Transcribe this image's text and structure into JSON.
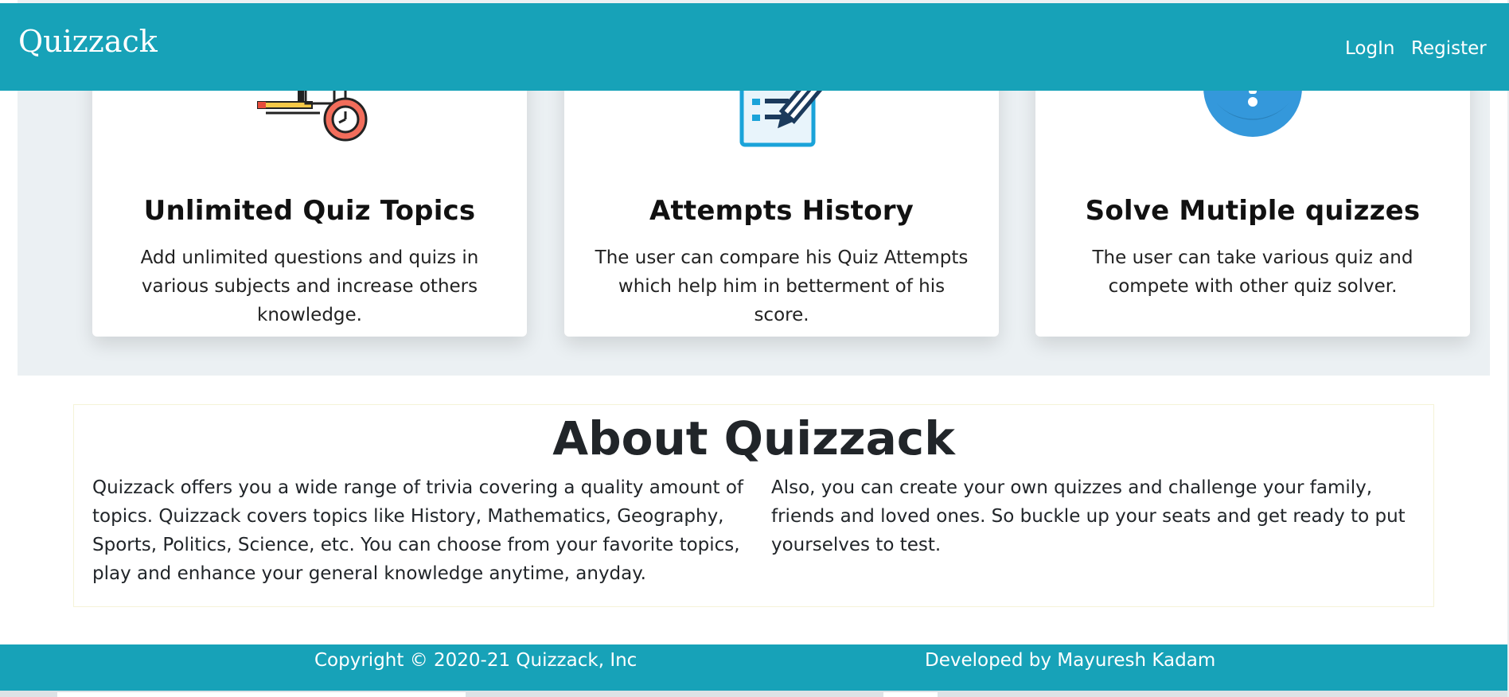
{
  "navbar": {
    "brand": "Quizzack",
    "links": [
      {
        "label": "LogIn"
      },
      {
        "label": "Register"
      }
    ]
  },
  "features": [
    {
      "icon": "quiz-timer-icon",
      "title": "Unlimited Quiz Topics",
      "description": "Add unlimited questions and quizs in various subjects and increase others knowledge."
    },
    {
      "icon": "checklist-pencil-icon",
      "title": "Attempts History",
      "description": "The user can compare his Quiz Attempts which help him in betterment of his score."
    },
    {
      "icon": "question-circle-icon",
      "title": "Solve Mutiple quizzes",
      "description": "The user can take various quiz and compete with other quiz solver."
    }
  ],
  "about": {
    "heading": "About Quizzack",
    "left_text": "Quizzack offers you a wide range of trivia covering a quality amount of topics. Quizzack covers topics like History, Mathematics, Geography, Sports, Politics, Science, etc. You can choose from your favorite topics, play and enhance your general knowledge anytime, anyday.",
    "right_text": "Also, you can create your own quizzes and challenge your family, friends and loved ones. So buckle up your seats and get ready to put yourselves to test."
  },
  "footer": {
    "copyright": "Copyright © 2020-21 Quizzack, Inc",
    "developer": "Developed by Mayuresh Kadam"
  },
  "colors": {
    "primary": "#17a2b8",
    "band": "#ebf0f3",
    "icon_blue": "#3498db",
    "icon_red": "#f26d5b"
  }
}
